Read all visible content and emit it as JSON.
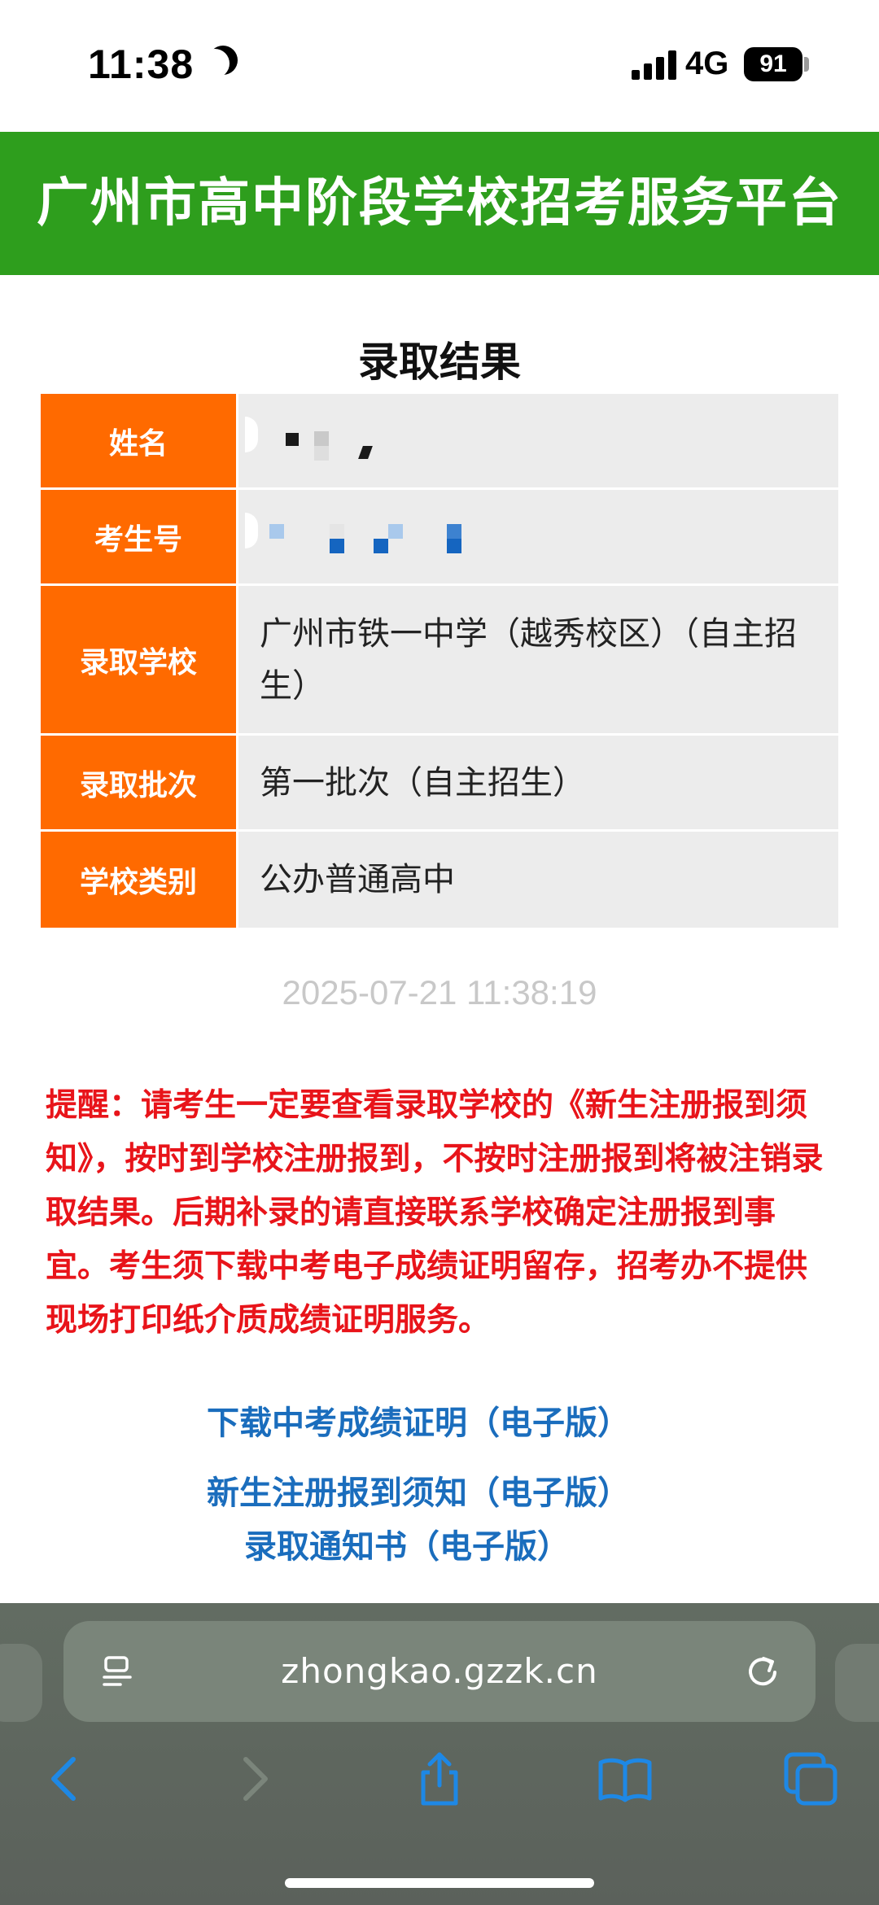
{
  "status": {
    "time": "11:38",
    "network": "4G",
    "battery": "91"
  },
  "header": {
    "title": "广州市高中阶段学校招考服务平台"
  },
  "result": {
    "title": "录取结果",
    "rows": [
      {
        "label": "姓名",
        "value": ""
      },
      {
        "label": "考生号",
        "value": ""
      },
      {
        "label": "录取学校",
        "value": "广州市铁一中学（越秀校区）（自主招生）"
      },
      {
        "label": "录取批次",
        "value": "第一批次（自主招生）"
      },
      {
        "label": "学校类别",
        "value": "公办普通高中"
      }
    ]
  },
  "timestamp": "2025-07-21 11:38:19",
  "reminder": "提醒：请考生一定要查看录取学校的《新生注册报到须知》，按时到学校注册报到，不按时注册报到将被注销录取结果。后期补录的请直接联系学校确定注册报到事宜。考生须下载中考电子成绩证明留存，招考办不提供现场打印纸介质成绩证明服务。",
  "links": {
    "download_score": "下载中考成绩证明（电子版）",
    "registration_notice": "新生注册报到须知（电子版）",
    "admission_letter": "录取通知书（电子版）"
  },
  "browser": {
    "url": "zhongkao.gzzk.cn"
  },
  "colors": {
    "header_green": "#2e9e1d",
    "label_orange": "#ff6a00",
    "reminder_red": "#e8141a",
    "link_blue": "#1a6dbd"
  }
}
